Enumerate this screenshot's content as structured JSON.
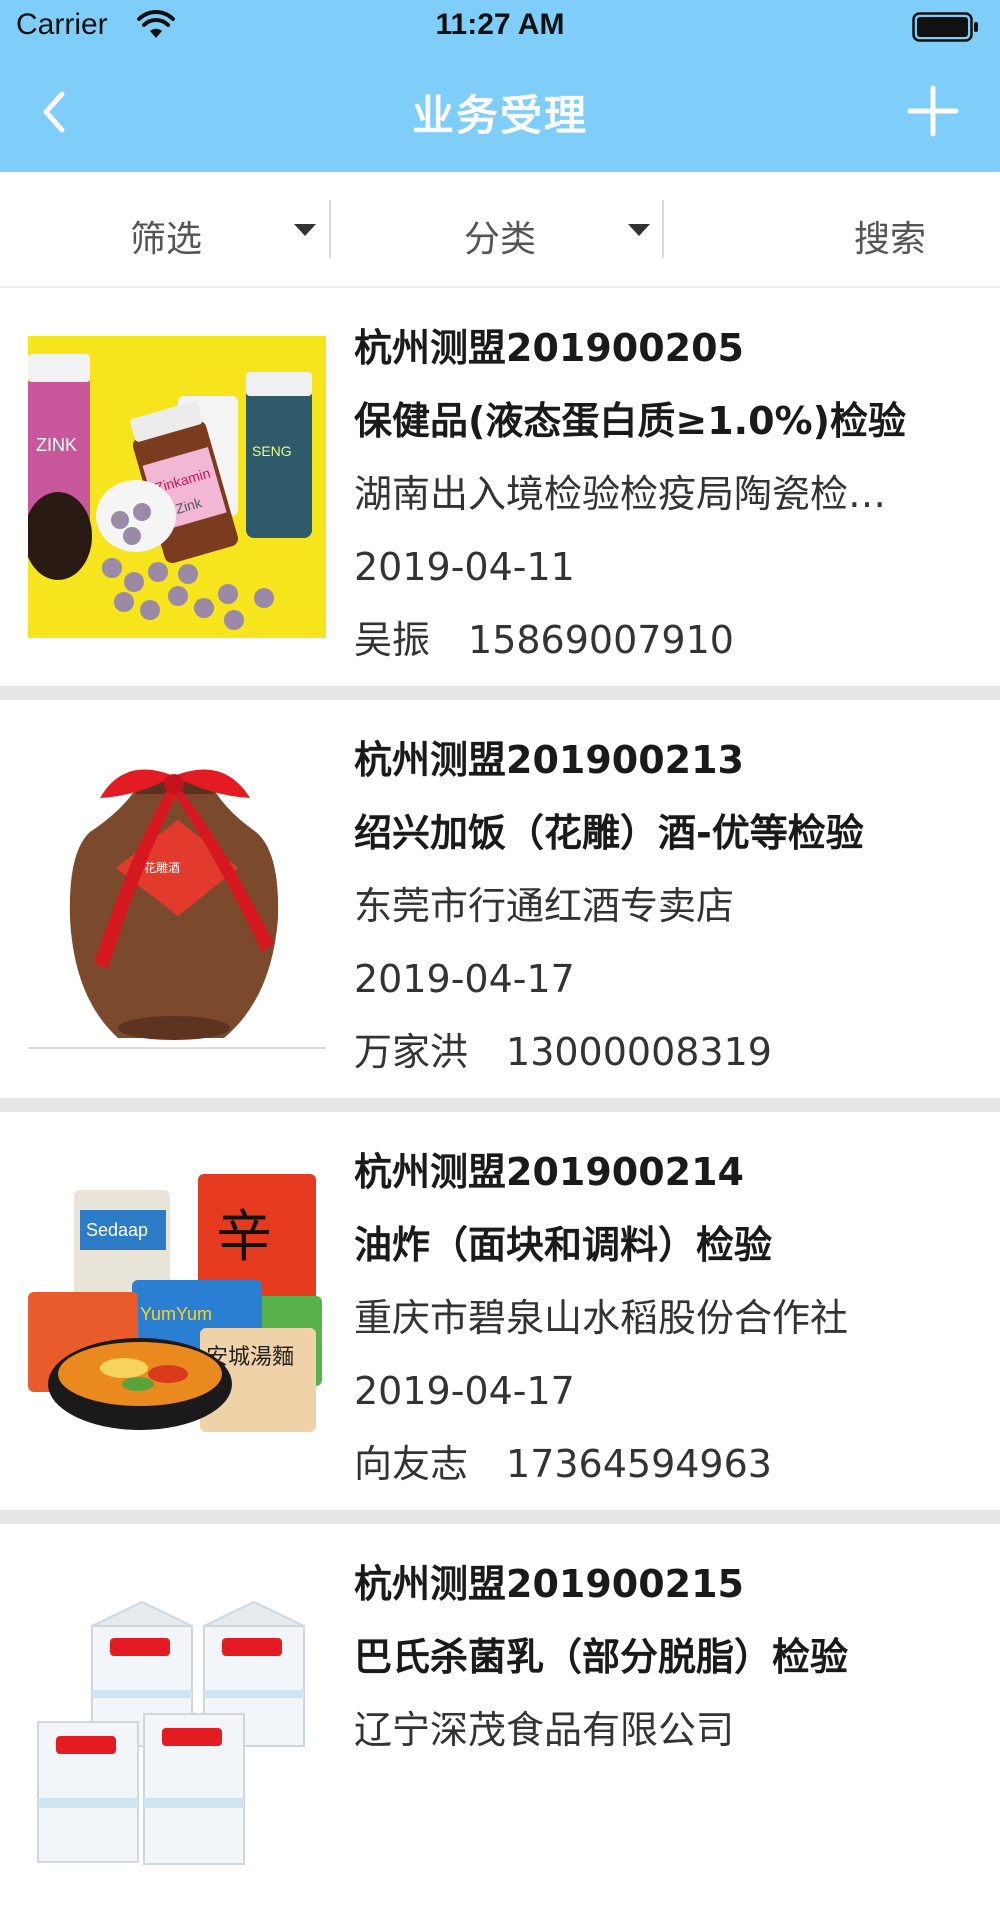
{
  "status_bar": {
    "carrier": "Carrier",
    "time": "11:27 AM"
  },
  "nav": {
    "title": "业务受理",
    "back_icon": "chevron-left-icon",
    "add_icon": "plus-icon"
  },
  "filters": {
    "filter_label": "筛选",
    "category_label": "分类",
    "search_label": "搜索"
  },
  "colors": {
    "header": "#7fcdf9",
    "separator": "#e6e6e6"
  },
  "items": [
    {
      "code": "杭州测盟201900205",
      "title": "保健品(液态蛋白质≥1.0%)检验",
      "company": "湖南出入境检验检疫局陶瓷检…",
      "date": "2019-04-11",
      "contact": "吴振",
      "phone": "15869007910",
      "image": "supplement-bottles-image"
    },
    {
      "code": "杭州测盟201900213",
      "title": "绍兴加饭（花雕）酒-优等检验",
      "company": "东莞市行通红酒专卖店",
      "date": "2019-04-17",
      "contact": "万家洪",
      "phone": "13000008319",
      "image": "wine-jar-image"
    },
    {
      "code": "杭州测盟201900214",
      "title": "油炸（面块和调料）检验",
      "company": "重庆市碧泉山水稻股份合作社",
      "date": "2019-04-17",
      "contact": "向友志",
      "phone": "17364594963",
      "image": "instant-noodles-image"
    },
    {
      "code": "杭州测盟201900215",
      "title": "巴氏杀菌乳（部分脱脂）检验",
      "company": "辽宁深茂食品有限公司",
      "date": "",
      "contact": "",
      "phone": "",
      "image": "milk-cartons-image"
    }
  ]
}
